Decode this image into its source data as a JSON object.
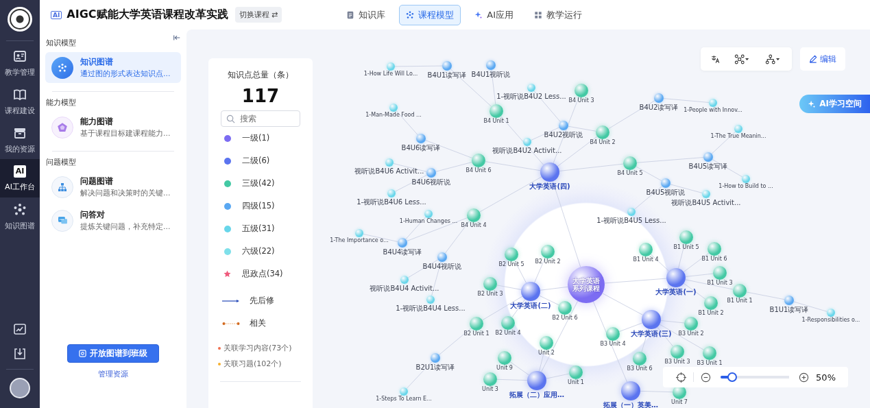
{
  "rail": {
    "items": [
      {
        "label": "教学管理",
        "selected": false
      },
      {
        "label": "课程建设",
        "selected": false
      },
      {
        "label": "我的资源",
        "selected": false
      },
      {
        "label": "AI工作台",
        "badge": "AI",
        "selected": true
      },
      {
        "label": "知识图谱",
        "selected": false
      }
    ]
  },
  "header": {
    "badge": "AI",
    "title": "AIGC赋能大学英语课程改革实践",
    "switch_button": "切换课程 ⇄",
    "tabs": [
      {
        "label": "知识库",
        "selected": false
      },
      {
        "label": "课程模型",
        "selected": true
      },
      {
        "label": "AI应用",
        "selected": false
      },
      {
        "label": "教学运行",
        "selected": false
      }
    ]
  },
  "sidebar": {
    "sections": [
      {
        "title": "知识模型",
        "items": [
          {
            "title": "知识图谱",
            "desc": "通过图的形式表达知识点…",
            "selected": true
          }
        ]
      },
      {
        "title": "能力模型",
        "items": [
          {
            "title": "能力图谱",
            "desc": "基于课程目标建课程能力…",
            "selected": false
          }
        ]
      },
      {
        "title": "问题模型",
        "items": [
          {
            "title": "问题图谱",
            "desc": "解决问题和决策时的关键…",
            "selected": false
          },
          {
            "title": "问答对",
            "desc": "提炼关键问题，补充特定…",
            "selected": false
          }
        ]
      }
    ],
    "primary_button": "开放图谱到班级",
    "link": "管理资源"
  },
  "legend": {
    "title": "知识点总量（条）",
    "total": "117",
    "search_placeholder": "搜索",
    "levels": [
      {
        "label": "一级(1)",
        "kind": "dot",
        "color": "#7c6cf2"
      },
      {
        "label": "二级(6)",
        "kind": "dot",
        "color": "#5b74ef"
      },
      {
        "label": "三级(42)",
        "kind": "dot",
        "color": "#43c9a4"
      },
      {
        "label": "四级(15)",
        "kind": "dot",
        "color": "#5aa8f2"
      },
      {
        "label": "五级(31)",
        "kind": "dot",
        "color": "#68d6ea"
      },
      {
        "label": "六级(22)",
        "kind": "dot",
        "color": "#7fe0ea"
      },
      {
        "label": "思政点(34)",
        "kind": "star",
        "color": "#ef5a7c"
      }
    ],
    "links": [
      {
        "label": "先后修",
        "kind": "arrow"
      },
      {
        "label": "相关",
        "kind": "dotted"
      }
    ],
    "stats": [
      {
        "label": "关联学习内容(73个)",
        "color": "#f07050"
      },
      {
        "label": "关联习题(102个)",
        "color": "#f5b030"
      }
    ]
  },
  "toolbar": {
    "edit_button": "编辑"
  },
  "ai_button": "AI学习空间",
  "zoom": {
    "level": 0.17,
    "percent": "50%"
  },
  "graph": {
    "root": {
      "label": "大学英语系列课程",
      "kind": "level1",
      "children": [
        {
          "label": "大学英语(四)",
          "kind": "level2",
          "children": [
            {
              "label": "B4 Unit 1",
              "kind": "level3",
              "children": [
                {
                  "label": "B4U1读写译",
                  "kind": "level4",
                  "children": [
                    {
                      "label": "1-How Life Will Lo...",
                      "kind": "level5"
                    }
                  ]
                },
                {
                  "label": "B4U1视听说",
                  "kind": "level4"
                }
              ]
            },
            {
              "label": "B4 Unit 3",
              "kind": "level3"
            },
            {
              "label": "B4 Unit 6",
              "kind": "level3",
              "children": [
                {
                  "label": "B4U6读写译",
                  "kind": "level4",
                  "children": [
                    {
                      "label": "1-Man-Made Food ...",
                      "kind": "level5"
                    }
                  ]
                },
                {
                  "label": "B4U6视听说",
                  "kind": "level4",
                  "children": [
                    {
                      "label": "视听说B4U6 Activit...",
                      "kind": "level5"
                    },
                    {
                      "label": "1-视听说B4U6 Less...",
                      "kind": "level5"
                    }
                  ]
                }
              ]
            },
            {
              "label": "B4 Unit 2",
              "kind": "level3",
              "children": [
                {
                  "label": "B4U2视听说",
                  "kind": "level4",
                  "children": [
                    {
                      "label": "1-视听说B4U2 Less...",
                      "kind": "level5"
                    },
                    {
                      "label": "视听说B4U2 Activit...",
                      "kind": "level5"
                    }
                  ]
                },
                {
                  "label": "B4U2读写译",
                  "kind": "level4",
                  "children": [
                    {
                      "label": "1-People with Innov...",
                      "kind": "level5"
                    }
                  ]
                }
              ]
            },
            {
              "label": "B4 Unit 5",
              "kind": "level3",
              "children": [
                {
                  "label": "B4U5读写译",
                  "kind": "level4",
                  "children": [
                    {
                      "label": "1-The True Meanin...",
                      "kind": "level5"
                    },
                    {
                      "label": "1-How to Build to ...",
                      "kind": "level5"
                    }
                  ]
                },
                {
                  "label": "B4U5视听说",
                  "kind": "level4",
                  "children": [
                    {
                      "label": "视听说B4U5 Activit...",
                      "kind": "level5"
                    },
                    {
                      "label": "1-视听说B4U5 Less...",
                      "kind": "level5"
                    }
                  ]
                }
              ]
            },
            {
              "label": "B4 Unit 4",
              "kind": "level3",
              "children": [
                {
                  "label": "B4U4读写译",
                  "kind": "level4",
                  "children": [
                    {
                      "label": "1-Human Changes ...",
                      "kind": "level5"
                    },
                    {
                      "label": "1-The Importance o...",
                      "kind": "level5"
                    }
                  ]
                },
                {
                  "label": "B4U4视听说",
                  "kind": "level4",
                  "children": [
                    {
                      "label": "视听说B4U4 Activit...",
                      "kind": "level5"
                    },
                    {
                      "label": "1-视听说B4U4 Less...",
                      "kind": "level5"
                    }
                  ]
                }
              ]
            }
          ]
        },
        {
          "label": "大学英语(一)",
          "kind": "level2",
          "children": [
            {
              "label": "B1 Unit 5",
              "kind": "level3"
            },
            {
              "label": "B1 Unit 6",
              "kind": "level3"
            },
            {
              "label": "B1 Unit 4",
              "kind": "level3"
            },
            {
              "label": "B1 Unit 3",
              "kind": "level3"
            },
            {
              "label": "B1 Unit 2",
              "kind": "level3"
            },
            {
              "label": "B1 Unit 1",
              "kind": "level3",
              "children": [
                {
                  "label": "B1U1读写译",
                  "kind": "level4",
                  "children": [
                    {
                      "label": "1-Responsibilities o...",
                      "kind": "level5"
                    }
                  ]
                }
              ]
            }
          ]
        },
        {
          "label": "大学英语(二)",
          "kind": "level2",
          "children": [
            {
              "label": "B2 Unit 2",
              "kind": "level3"
            },
            {
              "label": "B2 Unit 5",
              "kind": "level3"
            },
            {
              "label": "B2 Unit 3",
              "kind": "level3"
            },
            {
              "label": "B2 Unit 6",
              "kind": "level3"
            },
            {
              "label": "B2 Unit 4",
              "kind": "level3"
            },
            {
              "label": "B2 Unit 1",
              "kind": "level3",
              "children": [
                {
                  "label": "B2U1读写译",
                  "kind": "level4",
                  "children": [
                    {
                      "label": "1-Steps To Learn E...",
                      "kind": "level5"
                    }
                  ]
                }
              ]
            }
          ]
        },
        {
          "label": "大学英语(三)",
          "kind": "level2",
          "children": [
            {
              "label": "B3 Unit 4",
              "kind": "level3"
            },
            {
              "label": "B3 Unit 2",
              "kind": "level3"
            },
            {
              "label": "B3 Unit 3",
              "kind": "level3"
            },
            {
              "label": "B3 Unit 6",
              "kind": "level3"
            },
            {
              "label": "B3 Unit 1",
              "kind": "level3"
            }
          ]
        },
        {
          "label": "拓展（二）应用…",
          "kind": "level2",
          "children": [
            {
              "label": "Unit 2",
              "kind": "level3"
            },
            {
              "label": "Unit 9",
              "kind": "level3"
            },
            {
              "label": "Unit 3",
              "kind": "level3"
            },
            {
              "label": "Unit 1",
              "kind": "level3"
            }
          ]
        },
        {
          "label": "拓展（一）英美…",
          "kind": "level2",
          "children": [
            {
              "label": "Unit 7",
              "kind": "level3"
            }
          ]
        }
      ]
    }
  }
}
